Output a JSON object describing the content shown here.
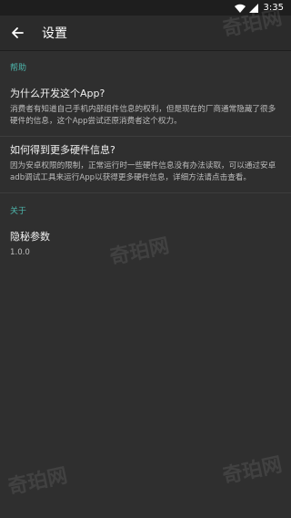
{
  "status_bar": {
    "time": "3:35"
  },
  "toolbar": {
    "back_icon": "arrow-left-icon",
    "title": "设置"
  },
  "sections": [
    {
      "header": "帮助",
      "items": [
        {
          "title": "为什么开发这个App?",
          "summary": "消费者有知道自己手机内部组件信息的权利，但是现在的厂商通常隐藏了很多硬件的信息，这个App尝试还原消费者这个权力。"
        },
        {
          "title": "如何得到更多硬件信息?",
          "summary": "因为安卓权限的限制，正常运行时一些硬件信息没有办法读取，可以通过安卓adb调试工具来运行App以获得更多硬件信息，详细方法请点击查看。"
        }
      ]
    },
    {
      "header": "关于",
      "items": [
        {
          "title": "隐秘参数",
          "summary": "1.0.0"
        }
      ]
    }
  ],
  "watermark": "奇珀网",
  "colors": {
    "accent": "#4db6ac",
    "background": "#2f2f2f",
    "toolbar": "#2b2b2b",
    "statusbar": "#1e1e1e"
  }
}
